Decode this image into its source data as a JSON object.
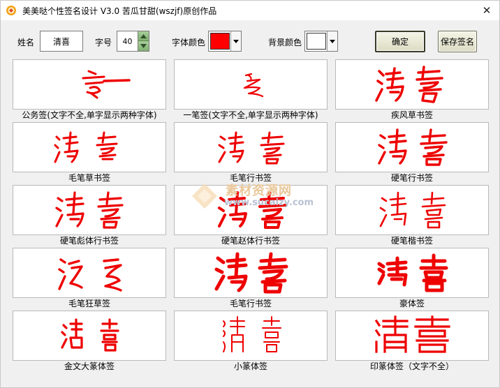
{
  "window": {
    "title": "美美哒个性签名设计 V3.0    苦瓜甘甜(wszjf)原创作品",
    "close_glyph": "✕"
  },
  "toolbar": {
    "name_label": "姓名",
    "name_value": "清喜",
    "size_label": "字号",
    "size_value": "40",
    "font_color_label": "字体颜色",
    "font_color": "#ff0000",
    "bg_color_label": "背景颜色",
    "bg_color": "#ffffff",
    "confirm_label": "确定",
    "save_label": "保存签名"
  },
  "signature_color": "#ee0000",
  "styles": [
    {
      "caption": "公务签(文字不全,单字显示两种字体)"
    },
    {
      "caption": "一笔签(文字不全,单字显示两种字体)"
    },
    {
      "caption": "疾风草书签"
    },
    {
      "caption": "毛笔草书签"
    },
    {
      "caption": "毛笔行书签"
    },
    {
      "caption": "硬笔行书签"
    },
    {
      "caption": "硬笔彪体行书签"
    },
    {
      "caption": "硬笔赵体行书签"
    },
    {
      "caption": "硬笔楷书签"
    },
    {
      "caption": "毛笔狂草签"
    },
    {
      "caption": "毛笔行书签"
    },
    {
      "caption": "豪体签"
    },
    {
      "caption": "金文大篆体签"
    },
    {
      "caption": "小篆体签"
    },
    {
      "caption": "印篆体签（文字不全）"
    }
  ],
  "watermark": {
    "text": "素材资源网",
    "url": "www.sucaizy.com"
  }
}
